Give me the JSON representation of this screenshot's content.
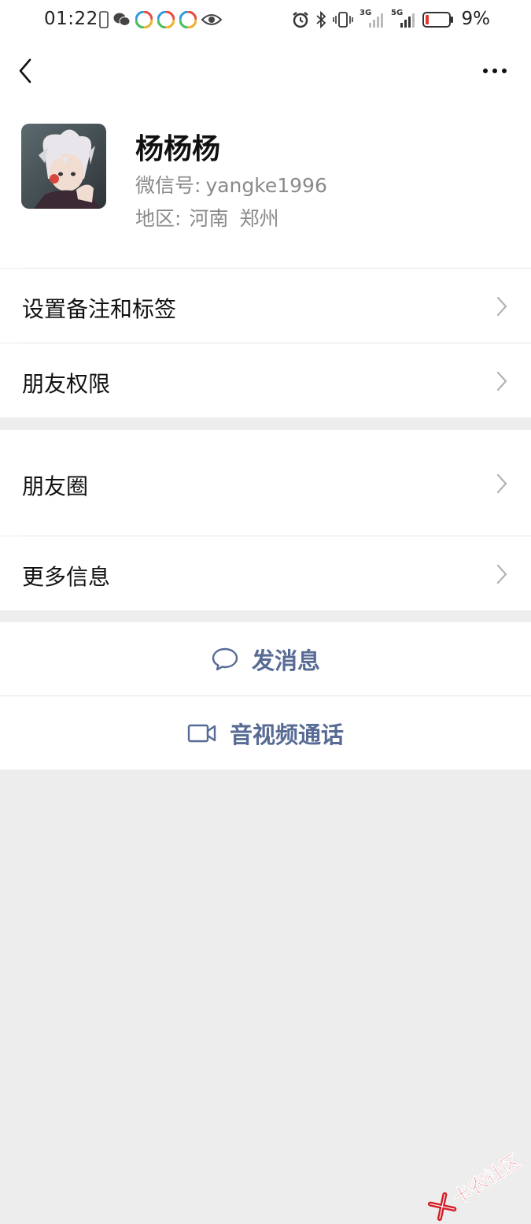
{
  "status_bar": {
    "time": "01:22",
    "battery_percent": "9%",
    "network_1": "3G",
    "network_2": "5G",
    "left_icons": [
      "phone-icon",
      "wechat-icon",
      "app-icon",
      "app-icon",
      "app-icon",
      "eye-icon"
    ],
    "right_icons": [
      "alarm-icon",
      "bluetooth-icon",
      "vibrate-icon",
      "signal-icon",
      "signal-icon",
      "battery-icon"
    ]
  },
  "nav": {
    "back_icon": "back-icon",
    "more_icon": "more-icon"
  },
  "profile": {
    "name": "杨杨杨",
    "wechat_id_label": "微信号:",
    "wechat_id": "yangke1996",
    "region_label": "地区:",
    "region_province": "河南",
    "region_city": "郑州"
  },
  "menu": {
    "remarks_tags": "设置备注和标签",
    "friend_permissions": "朋友权限",
    "moments": "朋友圈",
    "more_info": "更多信息"
  },
  "actions": {
    "send_message": "发消息",
    "av_call": "音视频通话"
  },
  "watermark": {
    "text": "卡农社区"
  },
  "colors": {
    "link_blue": "#576b95",
    "background_gray": "#ededed",
    "watermark_red": "#d21f26"
  }
}
